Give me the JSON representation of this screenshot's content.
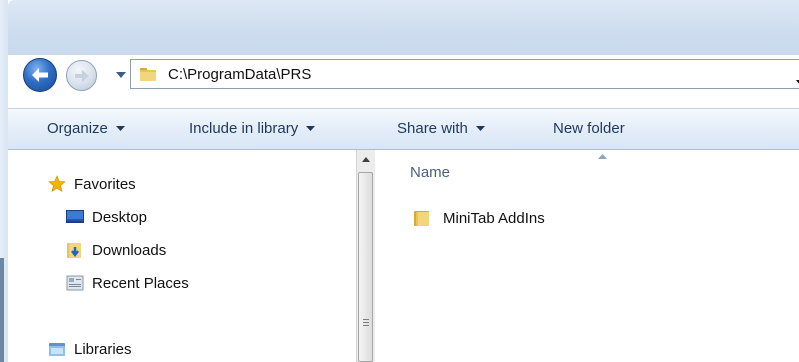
{
  "address": {
    "path": "C:\\ProgramData\\PRS"
  },
  "toolbar": {
    "organize": "Organize",
    "include_in_library": "Include in library",
    "share_with": "Share with",
    "new_folder": "New folder"
  },
  "nav": {
    "favorites": "Favorites",
    "desktop": "Desktop",
    "downloads": "Downloads",
    "recent_places": "Recent Places",
    "libraries": "Libraries"
  },
  "content": {
    "column_name": "Name",
    "items": [
      {
        "name": "MiniTab AddIns",
        "icon": "folder-icon"
      }
    ]
  },
  "colors": {
    "toolbar_text": "#1e395b",
    "folder": "#e8c35a",
    "accent": "#2f6ec5"
  }
}
